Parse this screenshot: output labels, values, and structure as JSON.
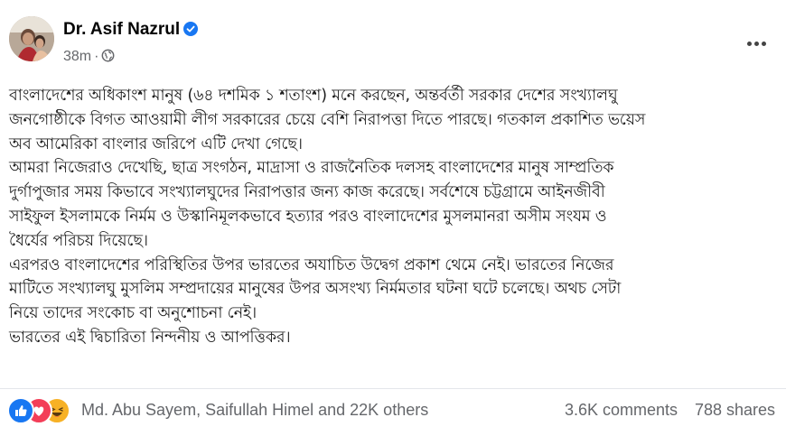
{
  "post": {
    "author": "Dr. Asif Nazrul",
    "time": "38m",
    "separator": "·",
    "paragraphs": [
      [
        "বাংলাদেশের অধিকাংশ মানুষ (৬৪ দশমিক ১ শতাংশ) মনে করছেন, অন্তর্বর্তী সরকার দেশের সংখ্যালঘু",
        "জনগোষ্ঠীকে বিগত আওয়ামী লীগ সরকারের চেয়ে বেশি নিরাপত্তা দিতে পারছে। গতকাল প্রকাশিত ভয়েস",
        "অব আমেরিকা বাংলার জরিপে এটি দেখা গেছে।"
      ],
      [
        "আমরা নিজেরাও দেখেছি, ছাত্র সংগঠন, মাদ্রাসা ও রাজনৈতিক দলসহ বাংলাদেশের মানুষ সাম্প্রতিক",
        "দুর্গাপুজার সময় কিভাবে সংখ্যালঘুদের নিরাপত্তার জন্য কাজ করেছে। সর্বশেষে চট্টগ্রামে আইনজীবী",
        "সাইফুল ইসলামকে নির্মম ও উস্কানিমূলকভাবে হত্যার পরও বাংলাদেশের  মুসলমানরা অসীম সংযম ও",
        "ধৈর্যের পরিচয় দিয়েছে।"
      ],
      [
        "এরপরও বাংলাদেশের পরিস্থিতির উপর ভারতের অযাচিত উদ্বেগ প্রকাশ থেমে নেই। ভারতের নিজের",
        "মাটিতে সংখ্যালঘু মুসলিম সম্প্রদায়ের মানুষের উপর অসংখ্য নির্মমতার ঘটনা ঘটে চলেছে। অথচ সেটা",
        "নিয়ে তাদের সংকোচ বা অনুশোচনা নেই।"
      ],
      [
        "ভারতের এই দ্বিচারিতা নিন্দনীয় ও আপত্তিকর।"
      ]
    ]
  },
  "reactions": {
    "icons": [
      "like-icon",
      "love-icon",
      "haha-icon"
    ],
    "names": "Md. Abu Sayem, Saifullah Himel and 22K others",
    "comments": "3.6K comments",
    "shares": "788 shares"
  },
  "colors": {
    "like": "#1877f2",
    "love": "#f33e58",
    "haha": "#f7b125",
    "verified": "#1877f2",
    "muted": "#65676b"
  }
}
